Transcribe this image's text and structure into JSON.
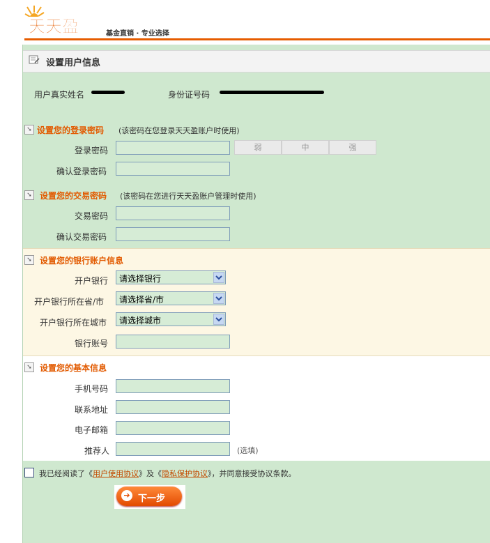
{
  "header": {
    "logo_text": "天天盈",
    "slogan": "基金直销 · 专业选择",
    "brand_color": "#e65c00"
  },
  "page": {
    "title": "设置用户信息"
  },
  "identity": {
    "name_label": "用户真实姓名",
    "id_label": "身份证号码"
  },
  "login": {
    "title": "设置您的登录密码",
    "note": "(该密码在您登录天天盈账户时使用)",
    "password_label": "登录密码",
    "confirm_label": "确认登录密码",
    "strength": [
      "弱",
      "中",
      "强"
    ]
  },
  "trade": {
    "title": "设置您的交易密码",
    "note": "(该密码在您进行天天盈账户管理时使用)",
    "password_label": "交易密码",
    "confirm_label": "确认交易密码"
  },
  "bank": {
    "title": "设置您的银行账户信息",
    "bank_label": "开户银行",
    "bank_value": "请选择银行",
    "province_label": "开户银行所在省/市",
    "province_value": "请选择省/市",
    "city_label": "开户银行所在城市",
    "city_value": "请选择城市",
    "account_label": "银行账号"
  },
  "basic": {
    "title": "设置您的基本信息",
    "phone_label": "手机号码",
    "address_label": "联系地址",
    "email_label": "电子邮箱",
    "referrer_label": "推荐人",
    "optional_note": "(选填)"
  },
  "agreement": {
    "text_1": "我已经阅读了《",
    "link_1": "用户使用协议",
    "text_2": "》及《",
    "link_2": "隐私保护协议",
    "text_3": "》，并同意接受协议条款。"
  },
  "next_button": {
    "label": "下一步"
  }
}
